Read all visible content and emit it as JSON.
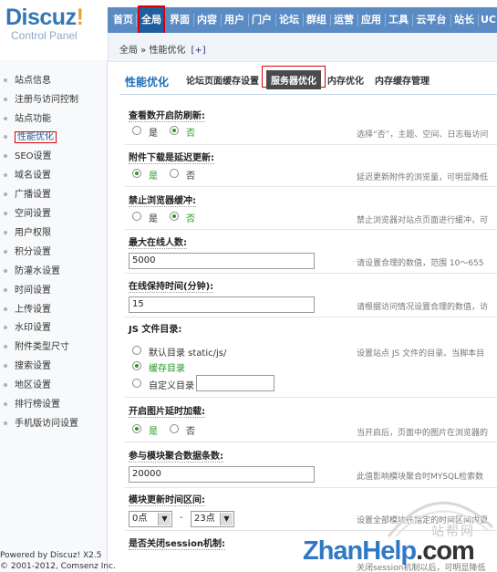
{
  "logo": {
    "main": "Discuz",
    "bang": "!",
    "sub": "Control Panel"
  },
  "nav": {
    "items": [
      "首页",
      "全局",
      "界面",
      "内容",
      "用户",
      "门户",
      "论坛",
      "群组",
      "运营",
      "应用",
      "工具",
      "云平台",
      "站长",
      "UC"
    ],
    "active": "全局"
  },
  "breadcrumb": {
    "text": "全局 » 性能优化",
    "add": "[+]"
  },
  "sidebar": {
    "items": [
      "站点信息",
      "注册与访问控制",
      "站点功能",
      "性能优化",
      "SEO设置",
      "域名设置",
      "广播设置",
      "空间设置",
      "用户权限",
      "积分设置",
      "防灌水设置",
      "时间设置",
      "上传设置",
      "水印设置",
      "附件类型尺寸",
      "搜索设置",
      "地区设置",
      "排行榜设置",
      "手机版访问设置"
    ],
    "active": "性能优化",
    "footer_line1": "Powered by Discuz! X2.5",
    "footer_line2": "© 2001-2012, Comsenz Inc."
  },
  "tabs": {
    "title": "性能优化",
    "items": [
      "论坛页面缓存设置",
      "服务器优化",
      "内存优化",
      "内存缓存管理"
    ],
    "active": "服务器优化"
  },
  "form": {
    "s1": {
      "label": "查看数开启防刷新:",
      "opt_yes": "是",
      "opt_no": "否",
      "selected": "否",
      "hint": "选择“否”，主题、空间、日志每访问"
    },
    "s2": {
      "label": "附件下载是延迟更新:",
      "opt_yes": "是",
      "opt_no": "否",
      "selected": "是",
      "hint": "延迟更新附件的浏览量，可明显降低"
    },
    "s3": {
      "label": "禁止浏览器缓冲:",
      "opt_yes": "是",
      "opt_no": "否",
      "selected": "否",
      "hint": "禁止浏览器对站点页面进行缓冲，可"
    },
    "s4": {
      "label": "最大在线人数:",
      "value": "5000",
      "hint": "请设置合理的数值，范围 10～655"
    },
    "s5": {
      "label": "在线保持时间(分钟):",
      "value": "15",
      "hint": "请根据访问情况设置合理的数值，访"
    },
    "s6": {
      "label": "JS 文件目录:",
      "opt1": "默认目录 static/js/",
      "opt2": "缓存目录",
      "opt3": "自定义目录",
      "selected": "缓存目录",
      "custom_value": "",
      "hint": "设置站点 JS 文件的目录。当脚本目"
    },
    "s7": {
      "label": "开启图片延时加载:",
      "opt_yes": "是",
      "opt_no": "否",
      "selected": "是",
      "hint": "当开启后，页面中的图片在浏览器的"
    },
    "s8": {
      "label": "参与模块聚合数据条数:",
      "value": "20000",
      "hint": "此值影响模块聚合时MYSQL检索数"
    },
    "s9": {
      "label": "模块更新时间区间:",
      "from": "0点",
      "to": "23点",
      "sep": "-",
      "hint": "设置全部模块在指定的时间区间内更"
    },
    "s10": {
      "label": "是否关闭session机制:",
      "hint": "关闭session机制以后，可明显降低"
    }
  },
  "watermark": {
    "brand": "ZhanHelp",
    "dot": ".",
    "tld": "com",
    "cn": "站帮网"
  },
  "colors": {
    "nav_bg": "#5a8bc4",
    "active_nav": "#1f5e9f",
    "selected_green": "#2a9a2a",
    "highlight_red": "#dd0000"
  }
}
